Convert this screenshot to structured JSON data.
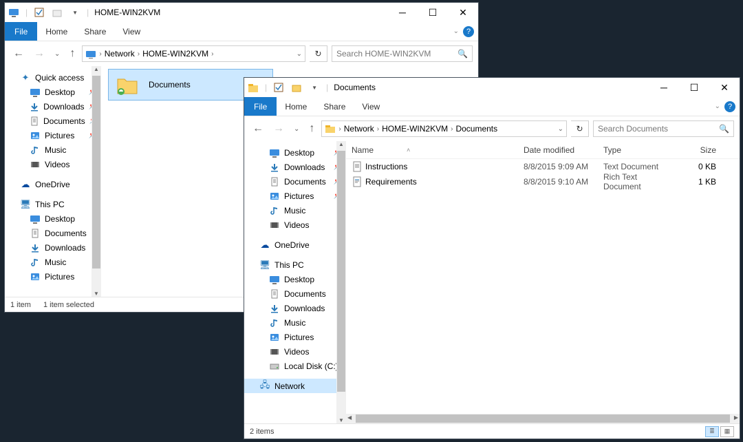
{
  "window1": {
    "title": "HOME-WIN2KVM",
    "ribbon": {
      "file": "File",
      "tabs": [
        "Home",
        "Share",
        "View"
      ]
    },
    "breadcrumb": [
      "Network",
      "HOME-WIN2KVM"
    ],
    "searchPlaceholder": "Search HOME-WIN2KVM",
    "nav": {
      "quickAccess": "Quick access",
      "qa": [
        {
          "label": "Desktop",
          "icon": "monitor",
          "pinned": true
        },
        {
          "label": "Downloads",
          "icon": "down",
          "pinned": true
        },
        {
          "label": "Documents",
          "icon": "doc",
          "pinned": true
        },
        {
          "label": "Pictures",
          "icon": "pic",
          "pinned": true
        },
        {
          "label": "Music",
          "icon": "music",
          "pinned": false
        },
        {
          "label": "Videos",
          "icon": "video",
          "pinned": false
        }
      ],
      "oneDrive": "OneDrive",
      "thisPC": "This PC",
      "pc": [
        {
          "label": "Desktop",
          "icon": "monitor"
        },
        {
          "label": "Documents",
          "icon": "doc"
        },
        {
          "label": "Downloads",
          "icon": "down"
        },
        {
          "label": "Music",
          "icon": "music"
        },
        {
          "label": "Pictures",
          "icon": "pic"
        }
      ]
    },
    "selectedFolder": "Documents",
    "status": {
      "count": "1 item",
      "selection": "1 item selected"
    }
  },
  "window2": {
    "title": "Documents",
    "ribbon": {
      "file": "File",
      "tabs": [
        "Home",
        "Share",
        "View"
      ]
    },
    "breadcrumb": [
      "Network",
      "HOME-WIN2KVM",
      "Documents"
    ],
    "searchPlaceholder": "Search Documents",
    "nav": {
      "qa": [
        {
          "label": "Desktop",
          "icon": "monitor",
          "pinned": true
        },
        {
          "label": "Downloads",
          "icon": "down",
          "pinned": true
        },
        {
          "label": "Documents",
          "icon": "doc",
          "pinned": true
        },
        {
          "label": "Pictures",
          "icon": "pic",
          "pinned": true
        },
        {
          "label": "Music",
          "icon": "music",
          "pinned": false
        },
        {
          "label": "Videos",
          "icon": "video",
          "pinned": false
        }
      ],
      "oneDrive": "OneDrive",
      "thisPC": "This PC",
      "pc": [
        {
          "label": "Desktop",
          "icon": "monitor"
        },
        {
          "label": "Documents",
          "icon": "doc"
        },
        {
          "label": "Downloads",
          "icon": "down"
        },
        {
          "label": "Music",
          "icon": "music"
        },
        {
          "label": "Pictures",
          "icon": "pic"
        },
        {
          "label": "Videos",
          "icon": "video"
        },
        {
          "label": "Local Disk (C:)",
          "icon": "disk"
        }
      ],
      "network": "Network"
    },
    "columns": {
      "name": "Name",
      "date": "Date modified",
      "type": "Type",
      "size": "Size"
    },
    "files": [
      {
        "name": "Instructions",
        "date": "8/8/2015 9:09 AM",
        "type": "Text Document",
        "size": "0 KB",
        "icon": "txt"
      },
      {
        "name": "Requirements",
        "date": "8/8/2015 9:10 AM",
        "type": "Rich Text Document",
        "size": "1 KB",
        "icon": "rtf"
      }
    ],
    "status": {
      "count": "2 items"
    }
  }
}
